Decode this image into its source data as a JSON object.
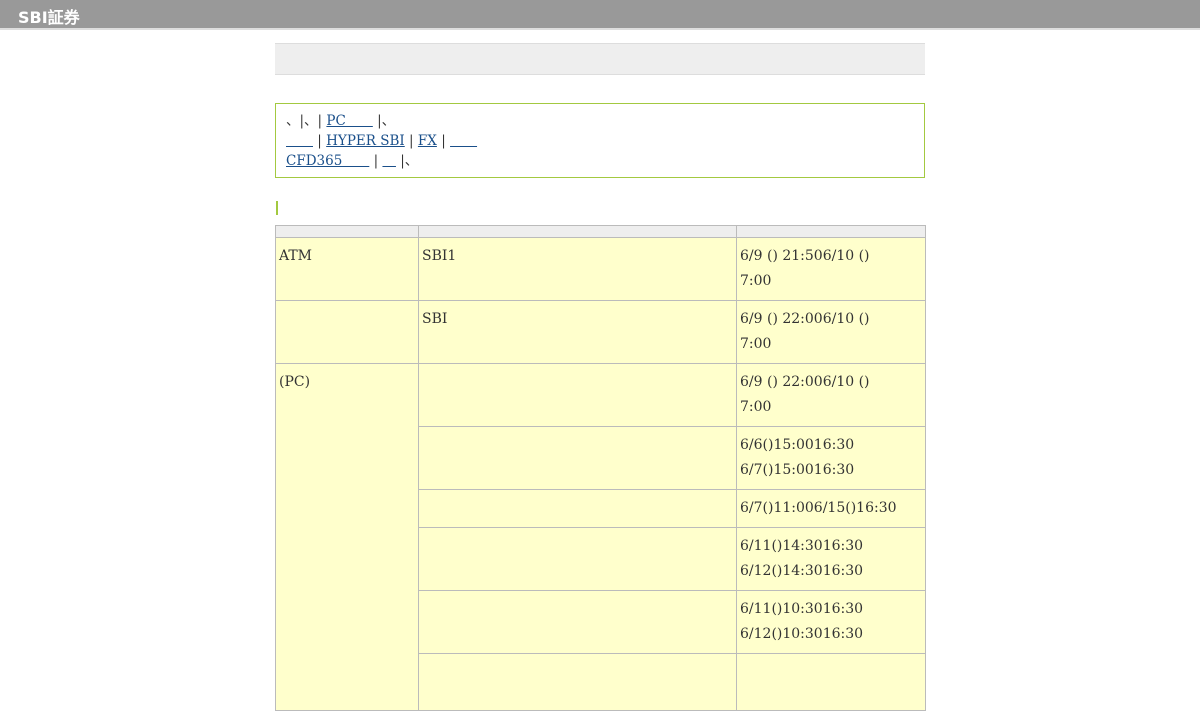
{
  "header": {
    "logo": "SBI証券"
  },
  "notice": {
    "line1": [
      {
        "text": "、|、|",
        "link": false
      },
      {
        "text": "PC　　",
        "link": true
      },
      {
        "text": "|、",
        "link": false
      }
    ],
    "line2": [
      {
        "text": "　　",
        "link": true
      },
      {
        "text": "|",
        "link": false
      },
      {
        "text": "HYPER SBI",
        "link": true
      },
      {
        "text": "|",
        "link": false
      },
      {
        "text": "FX",
        "link": true
      },
      {
        "text": "|",
        "link": false
      },
      {
        "text": "　　",
        "link": true
      }
    ],
    "line3": [
      {
        "text": "CFD365　　",
        "link": true
      },
      {
        "text": "|",
        "link": false
      },
      {
        "text": "　",
        "link": true
      },
      {
        "text": "|、",
        "link": false
      }
    ]
  },
  "table": {
    "headers": [
      "",
      "",
      ""
    ],
    "rows": [
      {
        "category": "ATM",
        "service": "SBI1",
        "times": [
          "6/9 () 21:506/10 ()",
          "7:00"
        ]
      },
      {
        "category": "",
        "service": "SBI",
        "times": [
          "6/9 () 22:006/10 ()",
          "7:00"
        ]
      },
      {
        "category": "(PC)",
        "service": "",
        "times": [
          "6/9 () 22:006/10 ()",
          "7:00"
        ]
      },
      {
        "category": "",
        "service": "",
        "times": [
          "6/6()15:0016:30",
          "6/7()15:0016:30"
        ]
      },
      {
        "category": "",
        "service": "",
        "times": [
          "6/7()11:006/15()16:30"
        ]
      },
      {
        "category": "",
        "service": "",
        "times": [
          "6/11()14:3016:30",
          "6/12()14:3016:30"
        ]
      },
      {
        "category": "",
        "service": "",
        "times": [
          "6/11()10:3016:30",
          "6/12()10:3016:30"
        ]
      },
      {
        "category": "",
        "service": "",
        "times": [
          ""
        ]
      }
    ]
  }
}
